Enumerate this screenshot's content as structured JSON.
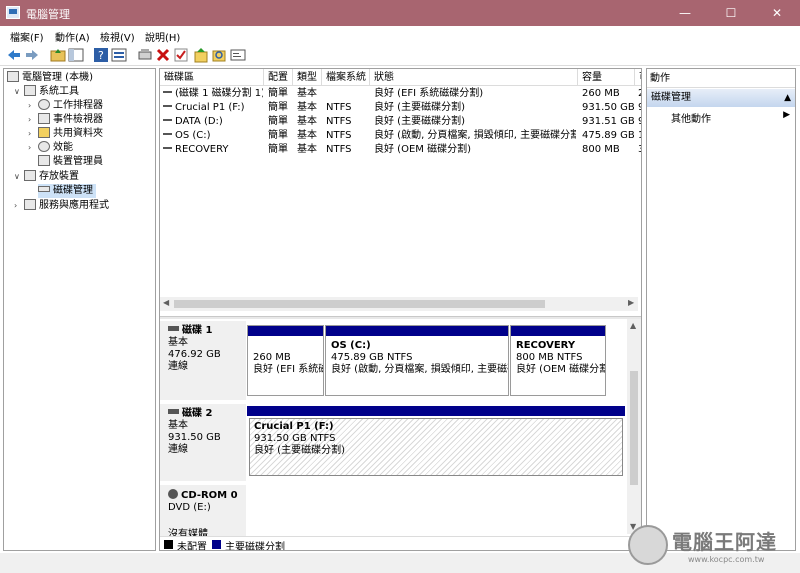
{
  "window": {
    "title": "電腦管理",
    "minimize": "—",
    "maximize": "☐",
    "close": "✕"
  },
  "menu": [
    "檔案(F)",
    "動作(A)",
    "檢視(V)",
    "說明(H)"
  ],
  "tree": {
    "root": "電腦管理 (本機)",
    "system_tools": "系統工具",
    "task_scheduler": "工作排程器",
    "event_viewer": "事件檢視器",
    "shared_folders": "共用資料夾",
    "performance": "效能",
    "device_manager": "裝置管理員",
    "storage": "存放裝置",
    "disk_management": "磁碟管理",
    "services_apps": "服務與應用程式"
  },
  "volume_table": {
    "headers": [
      "磁碟區",
      "配置",
      "類型",
      "檔案系統",
      "狀態",
      "容量",
      "可"
    ],
    "rows": [
      {
        "name": "(磁碟 1 磁碟分割 1)",
        "layout": "簡單",
        "type": "基本",
        "fs": "",
        "status": "良好 (EFI 系統磁碟分割)",
        "capacity": "260 MB",
        "free": "2"
      },
      {
        "name": "Crucial P1 (F:)",
        "layout": "簡單",
        "type": "基本",
        "fs": "NTFS",
        "status": "良好 (主要磁碟分割)",
        "capacity": "931.50 GB",
        "free": "9"
      },
      {
        "name": "DATA (D:)",
        "layout": "簡單",
        "type": "基本",
        "fs": "NTFS",
        "status": "良好 (主要磁碟分割)",
        "capacity": "931.51 GB",
        "free": "9"
      },
      {
        "name": "OS (C:)",
        "layout": "簡單",
        "type": "基本",
        "fs": "NTFS",
        "status": "良好 (啟動, 分頁檔案, 損毀傾印, 主要磁碟分割)",
        "capacity": "475.89 GB",
        "free": "1"
      },
      {
        "name": "RECOVERY",
        "layout": "簡單",
        "type": "基本",
        "fs": "NTFS",
        "status": "良好 (OEM 磁碟分割)",
        "capacity": "800 MB",
        "free": "3"
      }
    ]
  },
  "disks": [
    {
      "name": "磁碟 1",
      "type": "基本",
      "size": "476.92 GB",
      "state": "連線",
      "partitions": [
        {
          "title": "",
          "line1": "260 MB",
          "line2": "良好 (EFI 系統磁"
        },
        {
          "title": "OS  (C:)",
          "line1": "475.89 GB NTFS",
          "line2": "良好 (啟動, 分頁檔案, 損毀傾印, 主要磁碟"
        },
        {
          "title": "RECOVERY",
          "line1": "800 MB NTFS",
          "line2": "良好 (OEM 磁碟分割"
        }
      ]
    },
    {
      "name": "磁碟 2",
      "type": "基本",
      "size": "931.50 GB",
      "state": "連線",
      "partitions": [
        {
          "title": "Crucial P1  (F:)",
          "line1": "931.50 GB NTFS",
          "line2": "良好 (主要磁碟分割)"
        }
      ]
    },
    {
      "name": "CD-ROM 0",
      "type": "DVD (E:)",
      "state": "沒有媒體"
    }
  ],
  "legend": {
    "unallocated": "未配置",
    "primary": "主要磁碟分割"
  },
  "actions": {
    "header": "動作",
    "section": "磁碟管理",
    "more": "其他動作"
  },
  "watermark": {
    "text": "電腦王阿達",
    "url": "www.kocpc.com.tw"
  },
  "colors": {
    "titlebar": "#a86570",
    "partition_bar": "#00008a"
  },
  "icons": [
    "back-arrow-icon",
    "forward-arrow-icon",
    "up-folder-icon",
    "show-hide-tree-icon",
    "help-icon",
    "properties-icon",
    "connect-icon",
    "delete-icon",
    "check-icon",
    "refresh-icon",
    "search-icon",
    "export-icon"
  ]
}
